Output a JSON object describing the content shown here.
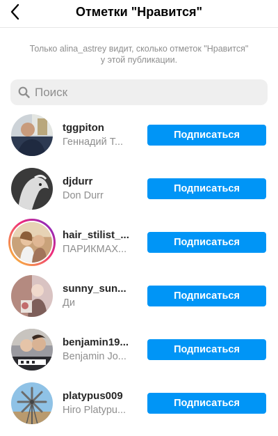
{
  "header": {
    "title": "Отметки \"Нравится\"",
    "back_icon": "chevron-left-icon"
  },
  "notice": "Только alina_astrey видит, сколько отметок \"Нравится\" у этой публикации.",
  "search": {
    "placeholder": "Поиск",
    "icon": "search-icon"
  },
  "colors": {
    "accent": "#0095f6",
    "secondary_text": "#8e8e8e",
    "search_bg": "#efefef"
  },
  "users": [
    {
      "username": "tggpiton",
      "full_name": "Геннадий Т...",
      "button": "Подписаться"
    },
    {
      "username": "djdurr",
      "full_name": "Don Durr",
      "button": "Подписаться"
    },
    {
      "username": "hair_stilist_...",
      "full_name": "ПАРИКМАХ...",
      "button": "Подписаться"
    },
    {
      "username": "sunny_sun...",
      "full_name": "Ди",
      "button": "Подписаться"
    },
    {
      "username": "benjamin19...",
      "full_name": "Benjamin Jo...",
      "button": "Подписаться"
    },
    {
      "username": "platypus009",
      "full_name": "Hiro Platypu...",
      "button": "Подписаться"
    }
  ]
}
